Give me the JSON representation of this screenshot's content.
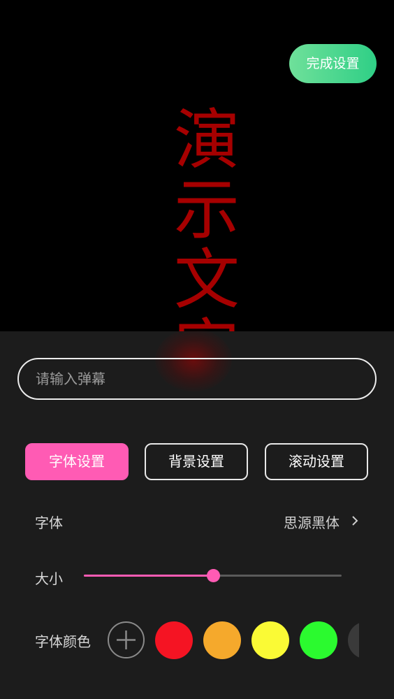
{
  "header": {
    "done_label": "完成设置"
  },
  "preview": {
    "text": "演示文字",
    "color": "#a60000"
  },
  "input": {
    "placeholder": "请输入弹幕",
    "value": ""
  },
  "tabs": [
    {
      "label": "字体设置",
      "active": true
    },
    {
      "label": "背景设置",
      "active": false
    },
    {
      "label": "滚动设置",
      "active": false
    }
  ],
  "font_row": {
    "label": "字体",
    "value": "思源黑体"
  },
  "size_row": {
    "label": "大小",
    "level": 0.5
  },
  "color_row": {
    "label": "字体颜色",
    "swatches": [
      "#f51423",
      "#f5a92c",
      "#fafa35",
      "#2bfa2f",
      "#3a3a3a"
    ]
  },
  "accent_color": "#ff5bb4"
}
